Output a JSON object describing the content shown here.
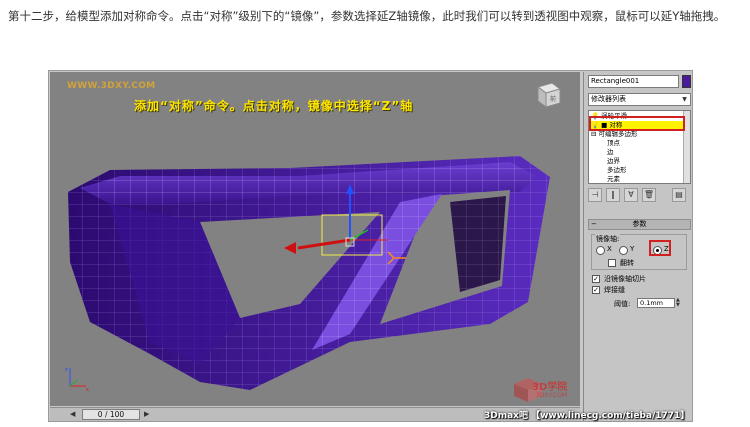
{
  "intro_text": "第十二步，给模型添加对称命令。点击“对称”级别下的“镜像”，参数选择延Z轴镜像，此时我们可以转到透视图中观察，鼠标可以延Y轴拖拽。",
  "viewport": {
    "watermark": "WWW.3DXY.COM",
    "caption": "添加“对称”命令。点击对称，镜像中选择“Z”轴",
    "viewcube_label": "前",
    "logo_text": "3D学院",
    "logo_sub": "3DXY.COM"
  },
  "timeline": {
    "slider_label": "0 / 100"
  },
  "panel": {
    "object_name": "Rectangle001",
    "object_color": "#4a1a9c",
    "modifier_list": "修改器列表",
    "stack": [
      "涡轮平滑",
      "对称",
      "可编辑多边形",
      "顶点",
      "边",
      "边界",
      "多边形",
      "元素"
    ],
    "selected_index": 1,
    "rollout_title": "参数",
    "mirror_axis_label": "镜像轴:",
    "axes": [
      "X",
      "Y",
      "Z"
    ],
    "selected_axis": "Z",
    "flip_label": "翻转",
    "slice_label": "沿镜像轴切片",
    "weld_label": "焊接缝",
    "threshold_label": "阈值:",
    "threshold_value": "0.1mm"
  },
  "credit": "3Dmax吧 【www.linecg.com/tieba/1771】",
  "colors": {
    "model": "#4b1ea8",
    "highlight": "#fff200",
    "annotation": "#d02020"
  }
}
